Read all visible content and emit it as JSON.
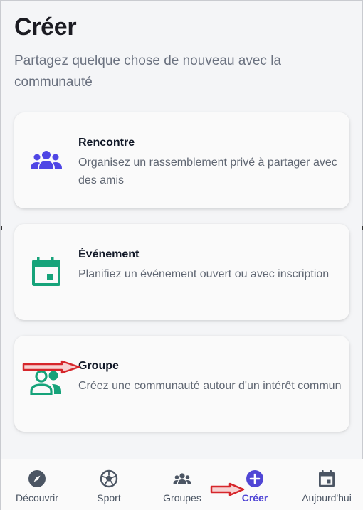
{
  "header": {
    "title": "Créer",
    "subtitle": "Partagez quelque chose de nouveau avec la communauté"
  },
  "cards": [
    {
      "title": "Rencontre",
      "description": "Organisez un rassemblement privé à partager avec des amis",
      "icon": "group-icon",
      "color": "#4f46e5"
    },
    {
      "title": "Événement",
      "description": "Planifiez un événement ouvert ou avec inscription",
      "icon": "calendar-icon",
      "color": "#16a37a"
    },
    {
      "title": "Groupe",
      "description": "Créez une communauté autour d'un intérêt commun",
      "icon": "people-icon",
      "color": "#16a37a"
    }
  ],
  "nav": {
    "items": [
      {
        "label": "Découvrir",
        "icon": "compass-icon"
      },
      {
        "label": "Sport",
        "icon": "ball-icon"
      },
      {
        "label": "Groupes",
        "icon": "groups-icon"
      },
      {
        "label": "Créer",
        "icon": "plus-circle-icon",
        "active": true
      },
      {
        "label": "Aujourd'hui",
        "icon": "calendar-icon"
      }
    ],
    "active_color": "#5046d5"
  },
  "annotations": {
    "arrow_color": "#d6262b"
  }
}
